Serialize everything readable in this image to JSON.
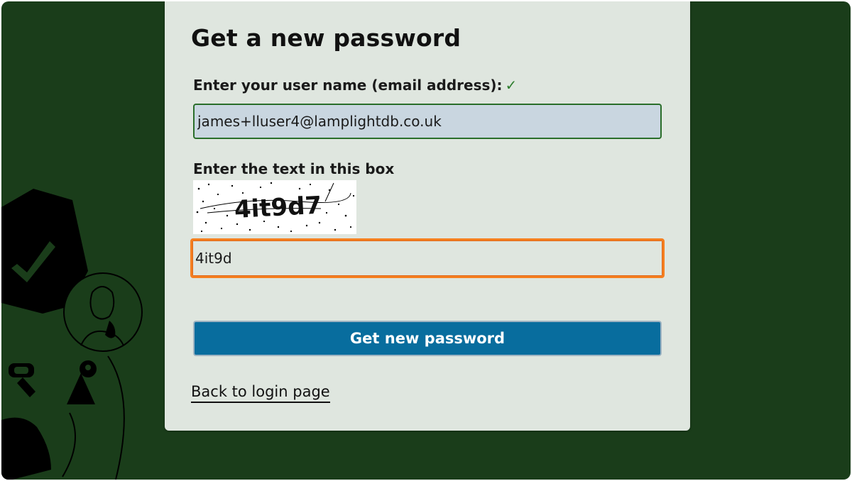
{
  "page": {
    "title": "Get a new password",
    "background_color": "#1a3d1a",
    "card_color": "#dfe6df"
  },
  "form": {
    "email_label": "Enter your user name (email address):",
    "email_valid_mark": "✓",
    "email_value": "james+lluser4@lamplightdb.co.uk",
    "captcha_label": "Enter the text in this box",
    "captcha_text": "4it9d7",
    "captcha_input_value": "4it9d",
    "submit_label": "Get new password",
    "focus_color": "#f57f1f",
    "button_color": "#086d9e"
  },
  "links": {
    "back_to_login": "Back to login page"
  }
}
